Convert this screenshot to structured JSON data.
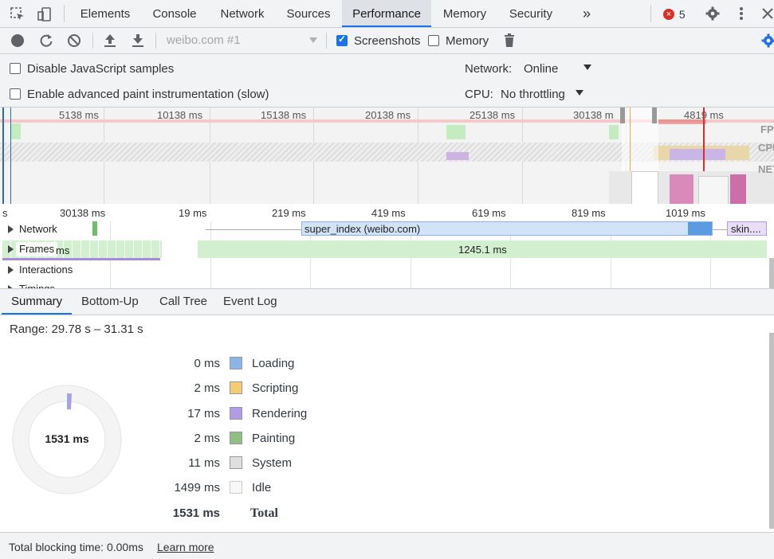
{
  "tabs": [
    "Elements",
    "Console",
    "Network",
    "Sources",
    "Performance",
    "Memory",
    "Security"
  ],
  "active_tab": "Performance",
  "more_tabs": "»",
  "error_count": "5",
  "toolbar": {
    "profile_select": "weibo.com #1",
    "screenshots_label": "Screenshots",
    "screenshots_checked": true,
    "memory_label": "Memory",
    "memory_checked": false
  },
  "options": {
    "disable_js_samples": "Disable JavaScript samples",
    "advanced_paint": "Enable advanced paint instrumentation (slow)",
    "network_label": "Network:",
    "network_value": "Online",
    "cpu_label": "CPU:",
    "cpu_value": "No throttling"
  },
  "overview": {
    "ticks": [
      "5138 ms",
      "10138 ms",
      "15138 ms",
      "20138 ms",
      "25138 ms",
      "30138 m",
      "4819 ms"
    ],
    "lanes": [
      "FPS",
      "CPU",
      "NET"
    ]
  },
  "flame": {
    "ticks": [
      "s",
      "30138 ms",
      "19 ms",
      "219 ms",
      "419 ms",
      "619 ms",
      "819 ms",
      "1019 ms"
    ],
    "tracks": [
      "Network",
      "Frames",
      "Interactions",
      "Timings"
    ],
    "network_request": "super_index (weibo.com)",
    "network_request2": "skin....",
    "frames_short": "ms",
    "frame_duration": "1245.1 ms"
  },
  "bottom_tabs": [
    "Summary",
    "Bottom-Up",
    "Call Tree",
    "Event Log"
  ],
  "summary": {
    "range": "Range: 29.78 s – 31.31 s",
    "total_center": "1531 ms",
    "rows": [
      {
        "ms": "0 ms",
        "label": "Loading",
        "color": "#8cb4e8"
      },
      {
        "ms": "2 ms",
        "label": "Scripting",
        "color": "#f2cd71"
      },
      {
        "ms": "17 ms",
        "label": "Rendering",
        "color": "#b19de6"
      },
      {
        "ms": "2 ms",
        "label": "Painting",
        "color": "#8fbf83"
      },
      {
        "ms": "11 ms",
        "label": "System",
        "color": "#dedede"
      },
      {
        "ms": "1499 ms",
        "label": "Idle",
        "color": "#f7f7f7"
      }
    ],
    "total_ms": "1531 ms",
    "total_label": "Total"
  },
  "footer": {
    "tbt": "Total blocking time: 0.00ms",
    "learn_more": "Learn more"
  }
}
